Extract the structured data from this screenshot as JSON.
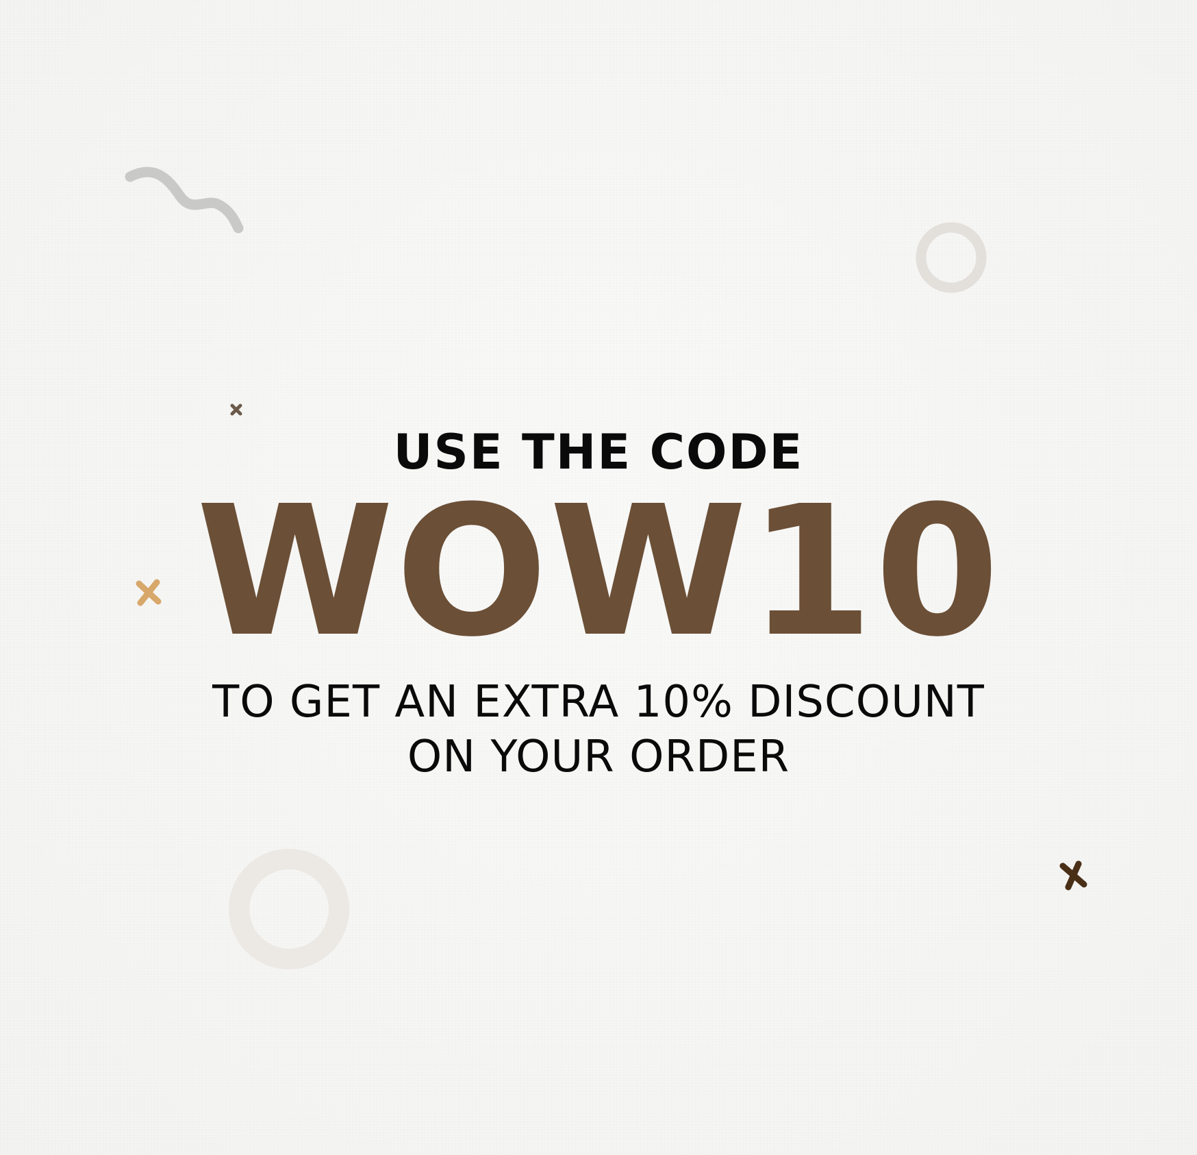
{
  "promo": {
    "lead": "USE THE CODE",
    "code": "WOW10",
    "line1": "TO GET AN EXTRA 10% DISCOUNT",
    "line2": "ON YOUR ORDER"
  },
  "colors": {
    "code": "#6b4f36",
    "text": "#0a0a0a",
    "background": "#f6f6f5",
    "squiggle": "#c9c9c7",
    "ring_light": "#e8e4df",
    "cross_gold": "#d7a86a",
    "cross_brown": "#4a2f17",
    "cross_small": "#6b5a4a"
  },
  "decorations": [
    "squiggle-icon",
    "ring-icon",
    "cross-icon"
  ]
}
